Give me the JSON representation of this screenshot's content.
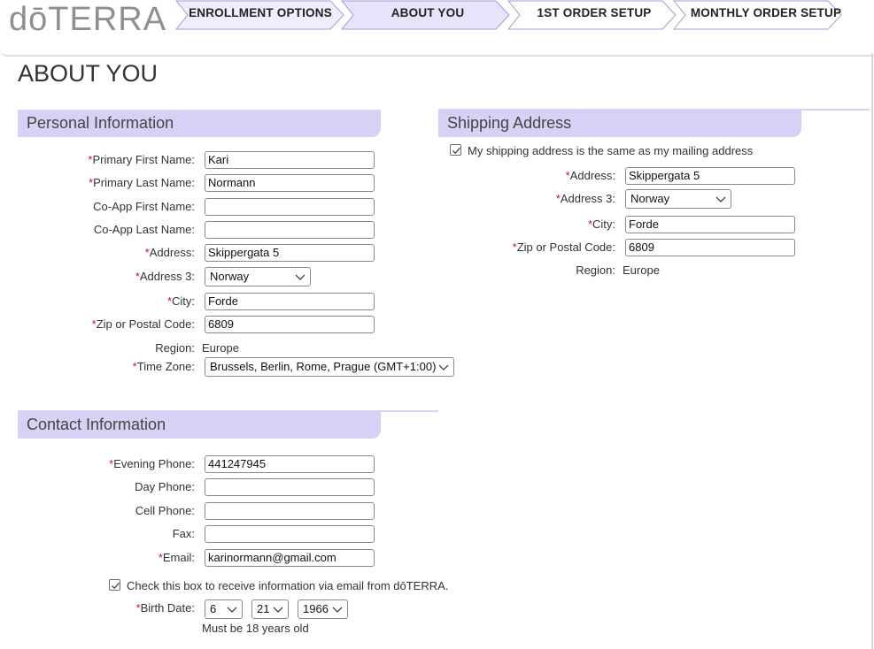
{
  "brand": {
    "logo_text": "dōTERRA"
  },
  "steps": [
    {
      "label": "ENROLLMENT OPTIONS",
      "active": false
    },
    {
      "label": "ABOUT YOU",
      "active": true
    },
    {
      "label": "1ST ORDER SETUP",
      "active": false
    },
    {
      "label": "MONTHLY ORDER SETUP",
      "active": false
    }
  ],
  "colors": {
    "accent": "#d8d0f5",
    "active_step": "#e8e2fb",
    "required": "#c8102e"
  },
  "page_title": "ABOUT YOU",
  "personal": {
    "heading": "Personal Information",
    "primary_first_name": {
      "label": "Primary First Name:",
      "value": "Kari"
    },
    "primary_last_name": {
      "label": "Primary Last Name:",
      "value": "Normann"
    },
    "coapp_first_name": {
      "label": "Co-App First Name:",
      "value": ""
    },
    "coapp_last_name": {
      "label": "Co-App Last Name:",
      "value": ""
    },
    "address": {
      "label": "Address:",
      "value": "Skippergata 5"
    },
    "address3": {
      "label": "Address 3:",
      "value": "Norway"
    },
    "city": {
      "label": "City:",
      "value": "Forde"
    },
    "zip": {
      "label": "Zip or Postal Code:",
      "value": "6809"
    },
    "region": {
      "label": "Region:",
      "value": "Europe"
    },
    "timezone": {
      "label": "Time Zone:",
      "value": "Brussels, Berlin, Rome, Prague (GMT+1:00)"
    }
  },
  "shipping": {
    "heading": "Shipping Address",
    "same_as_mailing": {
      "label": "My shipping address is the same as my mailing address",
      "checked": true
    },
    "address": {
      "label": "Address:",
      "value": "Skippergata 5"
    },
    "address3": {
      "label": "Address 3:",
      "value": "Norway"
    },
    "city": {
      "label": "City:",
      "value": "Forde"
    },
    "zip": {
      "label": "Zip or Postal Code:",
      "value": "6809"
    },
    "region": {
      "label": "Region:",
      "value": "Europe"
    }
  },
  "contact": {
    "heading": "Contact Information",
    "evening_phone": {
      "label": "Evening Phone:",
      "value": "441247945"
    },
    "day_phone": {
      "label": "Day Phone:",
      "value": ""
    },
    "cell_phone": {
      "label": "Cell Phone:",
      "value": ""
    },
    "fax": {
      "label": "Fax:",
      "value": ""
    },
    "email": {
      "label": "Email:",
      "value": "karinormann@gmail.com"
    },
    "email_optin": {
      "label": "Check this box to receive information via email from dōTERRA.",
      "checked": true
    },
    "birth_date": {
      "label": "Birth Date:",
      "month": "6",
      "day": "21",
      "year": "1966",
      "note": "Must be 18 years old"
    }
  },
  "required_marker": "*"
}
